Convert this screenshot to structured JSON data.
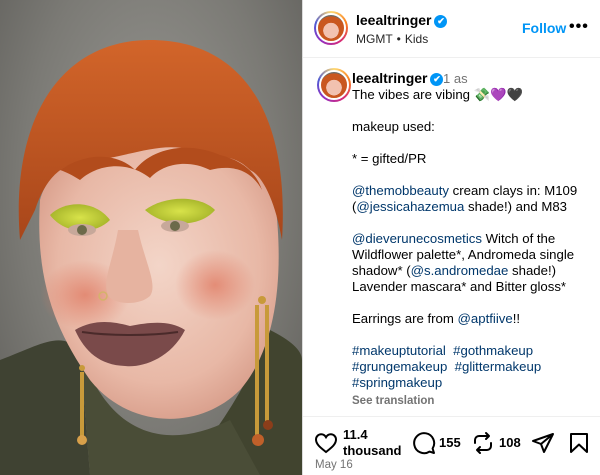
{
  "post": {
    "username": "leealtringer",
    "verified_mark": "✔",
    "sub_info": [
      "MGMT",
      "Kids"
    ],
    "follow_label": "Follow",
    "more_label": "•••",
    "time_ago": "1 as"
  },
  "caption": {
    "line1_text": "The vibes are vibing",
    "line1_emoji": "💸💜🖤",
    "makeup_used": "makeup used:",
    "gifted_note": "* = gifted/PR",
    "p1": {
      "link1": "@themobbeauty",
      "text1": " cream clays in: M109 (",
      "link2": "@jessicahazemua",
      "text2": " shade!) and M83"
    },
    "p2": {
      "link1": "@dieverunecosmetics",
      "text1": " Witch of the Wildflower palette*, Andromeda single shadow* (",
      "link2": "@s.andromedae",
      "text2": " shade!) Lavender mascara* and Bitter gloss*"
    },
    "p3": {
      "text1": "Earrings are from ",
      "link1": "@aptfiive",
      "text2": "!!"
    },
    "hashtags": [
      "#makeuptutorial",
      "#gothmakeup",
      "#grungemakeup",
      "#glittermakeup",
      "#springmakeup"
    ],
    "see_translation": "See translation"
  },
  "actions": {
    "likes": "11.4",
    "likes_unit": "thousand",
    "comments": "155",
    "reposts": "108",
    "date": "May 16"
  },
  "icons": [
    "verified-icon",
    "heart-icon",
    "comment-icon",
    "repost-icon",
    "share-icon",
    "bookmark-icon",
    "more-icon"
  ],
  "colors": {
    "accent": "#0095f6",
    "link": "#00376b",
    "muted": "#737373",
    "hair": "#c9571f",
    "eyeshadow": "#c8d23a"
  }
}
